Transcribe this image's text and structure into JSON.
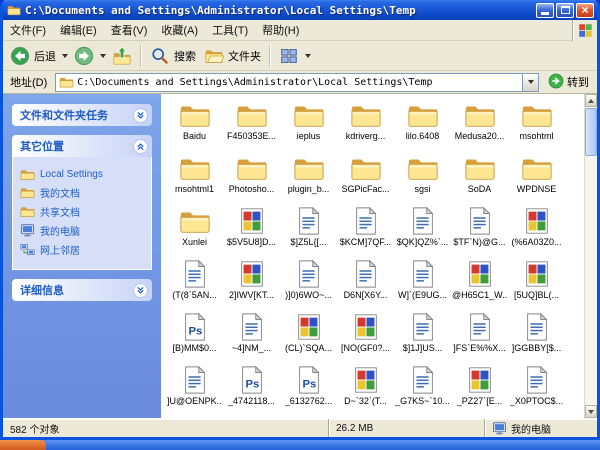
{
  "titlebar": {
    "title": "C:\\Documents and Settings\\Administrator\\Local Settings\\Temp"
  },
  "menu": {
    "items": [
      {
        "name": "file",
        "label": "文件(F)"
      },
      {
        "name": "edit",
        "label": "编辑(E)"
      },
      {
        "name": "view",
        "label": "查看(V)"
      },
      {
        "name": "favorites",
        "label": "收藏(A)"
      },
      {
        "name": "tools",
        "label": "工具(T)"
      },
      {
        "name": "help",
        "label": "帮助(H)"
      }
    ]
  },
  "toolbar": {
    "back_label": "后退",
    "search_label": "搜索",
    "folders_label": "文件夹"
  },
  "addressbar": {
    "label": "地址(D)",
    "value": "C:\\Documents and Settings\\Administrator\\Local Settings\\Temp",
    "go_label": "转到"
  },
  "sidebar": {
    "panels": [
      {
        "name": "file-and-folder-tasks",
        "title": "文件和文件夹任务",
        "collapsed": true,
        "items": []
      },
      {
        "name": "other-places",
        "title": "其它位置",
        "collapsed": false,
        "items": [
          {
            "name": "local-settings",
            "label": "Local Settings",
            "icon": "folder"
          },
          {
            "name": "my-documents",
            "label": "我的文档",
            "icon": "folder"
          },
          {
            "name": "shared-documents",
            "label": "共享文档",
            "icon": "folder"
          },
          {
            "name": "my-computer",
            "label": "我的电脑",
            "icon": "computer"
          },
          {
            "name": "network-places",
            "label": "网上邻居",
            "icon": "network"
          }
        ]
      },
      {
        "name": "details",
        "title": "详细信息",
        "collapsed": true,
        "items": []
      }
    ]
  },
  "files": {
    "items": [
      {
        "label": "Baidu",
        "icon": "folder"
      },
      {
        "label": "F450353E...",
        "icon": "folder"
      },
      {
        "label": "ieplus",
        "icon": "folder"
      },
      {
        "label": "kdriverg...",
        "icon": "folder"
      },
      {
        "label": "lilo.6408",
        "icon": "folder"
      },
      {
        "label": "Medusa20...",
        "icon": "folder"
      },
      {
        "label": "msohtml",
        "icon": "folder"
      },
      {
        "label": "msohtml1",
        "icon": "folder"
      },
      {
        "label": "Photosho...",
        "icon": "folder"
      },
      {
        "label": "plugin_b...",
        "icon": "folder"
      },
      {
        "label": "SGPicFac...",
        "icon": "folder"
      },
      {
        "label": "sgsi",
        "icon": "folder"
      },
      {
        "label": "SoDA",
        "icon": "folder"
      },
      {
        "label": "WPDNSE",
        "icon": "folder"
      },
      {
        "label": "Xunlei",
        "icon": "folder"
      },
      {
        "label": "$5V5U8]D...",
        "icon": "image"
      },
      {
        "label": "$]Z5L{[...",
        "icon": "doc"
      },
      {
        "label": "$KCM]7QF...",
        "icon": "doc"
      },
      {
        "label": "$QK]QZ%`...",
        "icon": "doc"
      },
      {
        "label": "$TF`N)@G...",
        "icon": "doc"
      },
      {
        "label": "(%6A03Z0...",
        "icon": "image"
      },
      {
        "label": "(T(8`5AN...",
        "icon": "doc"
      },
      {
        "label": "2]IWV[KT...",
        "icon": "image"
      },
      {
        "label": ")]0)6WO~...",
        "icon": "doc"
      },
      {
        "label": "D6N[X6Y...",
        "icon": "doc"
      },
      {
        "label": "W]`(E9UG...",
        "icon": "doc"
      },
      {
        "label": "@H65C1_W...",
        "icon": "image"
      },
      {
        "label": "[5UQ]BL(...",
        "icon": "image"
      },
      {
        "label": "[B)MM$0...",
        "icon": "ps"
      },
      {
        "label": "~4]NM_...",
        "icon": "doc"
      },
      {
        "label": "(CL)`SQA...",
        "icon": "image"
      },
      {
        "label": "[NO(GF0?...",
        "icon": "image"
      },
      {
        "label": "$]1J]US...",
        "icon": "doc"
      },
      {
        "label": "]FS`E%%X...",
        "icon": "doc"
      },
      {
        "label": "]GGBBY[$...",
        "icon": "doc"
      },
      {
        "label": "]U@OENPK...",
        "icon": "doc"
      },
      {
        "label": "_4742118...",
        "icon": "ps"
      },
      {
        "label": "_6132762...",
        "icon": "ps"
      },
      {
        "label": "D~`32`(T...",
        "icon": "image"
      },
      {
        "label": "_G7KS~`10...",
        "icon": "doc"
      },
      {
        "label": "_PZ27`[E...",
        "icon": "image"
      },
      {
        "label": "_X0PTOC$...",
        "icon": "doc"
      }
    ]
  },
  "statusbar": {
    "objects": "582 个对象",
    "size": "26.2 MB",
    "location": "我的电脑"
  },
  "colors": {
    "titlebar_blue": "#1b59d8",
    "window_border": "#0855dd",
    "taskpane_blue": "#7ea6ea",
    "panel_link_blue": "#215dc6",
    "chrome_beige": "#ece9d8",
    "taskbar_orange": "#cf5a1e",
    "taskbar_blue": "#2360d5"
  }
}
